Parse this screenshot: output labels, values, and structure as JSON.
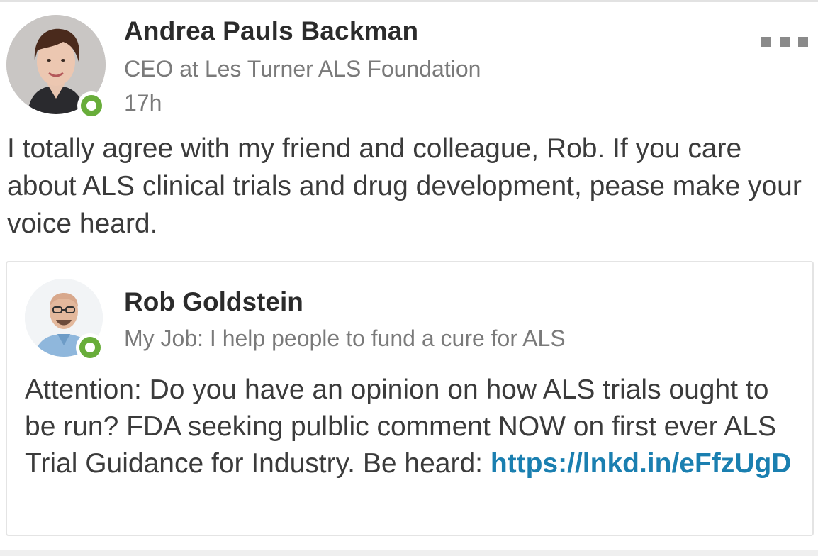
{
  "post": {
    "author": {
      "name": "Andrea Pauls Backman",
      "headline": "CEO at Les Turner ALS Foundation",
      "time": "17h",
      "avatar_icon": "profile-photo-woman",
      "presence_color": "#68ad3a"
    },
    "more_icon": "more-options-icon",
    "text": "I totally agree with my friend and colleague, Rob. If you care about ALS clinical trials and drug development, pease make your voice heard."
  },
  "shared": {
    "author": {
      "name": "Rob Goldstein",
      "headline": "My Job: I help people to fund a cure for ALS",
      "avatar_icon": "profile-photo-man",
      "presence_color": "#68ad3a"
    },
    "text": "Attention: Do you have an opinion on  how ALS trials ought to be run? FDA seeking pulblic comment NOW on first ever ALS Trial Guidance for Industry. Be heard: ",
    "link": "https://lnkd.in/eFfzUgD",
    "link_color": "#1a7fb0"
  }
}
